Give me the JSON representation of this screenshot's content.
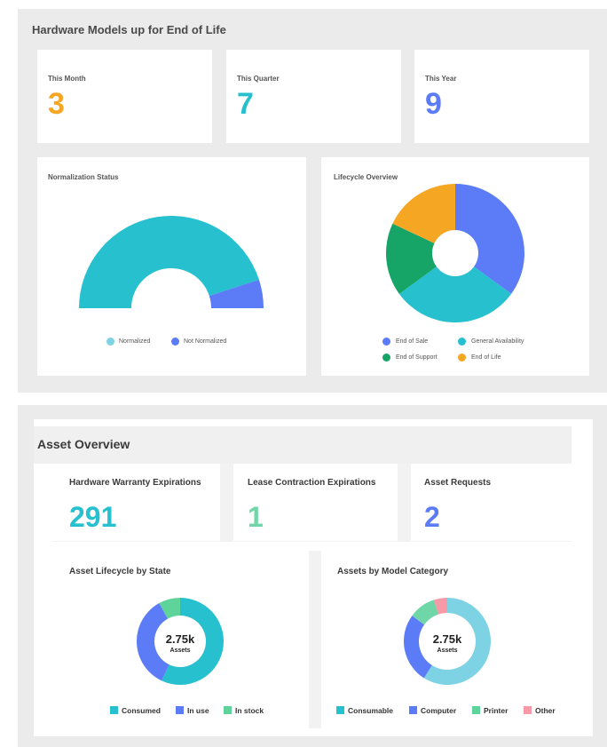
{
  "eol": {
    "title": "Hardware Models up for End of Life",
    "this_month_label": "This Month",
    "this_month_value": "3",
    "this_quarter_label": "This Quarter",
    "this_quarter_value": "7",
    "this_year_label": "This Year",
    "this_year_value": "9"
  },
  "normalization": {
    "title": "Normalization Status",
    "legend": [
      "Normalized",
      "Not Normalized"
    ]
  },
  "lifecycle": {
    "title": "Lifecycle Overview",
    "legend": [
      "End of Sale",
      "General Availability",
      "End of Support",
      "End of Life"
    ]
  },
  "asset_overview": {
    "title": "Asset Overview",
    "warranty_label": "Hardware Warranty Expirations",
    "warranty_value": "291",
    "lease_label": "Lease Contraction Expirations",
    "lease_value": "1",
    "requests_label": "Asset Requests",
    "requests_value": "2"
  },
  "asset_lifecycle": {
    "title": "Asset Lifecycle by State",
    "center_value": "2.75k",
    "center_label": "Assets",
    "legend": [
      "Consumed",
      "In use",
      "In stock"
    ]
  },
  "model_category": {
    "title": "Assets by Model Category",
    "center_value": "2.75k",
    "center_label": "Assets",
    "legend": [
      "Consumable",
      "Computer",
      "Printer",
      "Other"
    ]
  },
  "colors": {
    "orange": "#f5a623",
    "teal": "#26c0cf",
    "blue": "#5b7cf6",
    "green": "#16a567",
    "light_teal": "#7dd3e3",
    "light_green": "#6fd6a8",
    "pink": "#f59aa6",
    "mint": "#5ed39a"
  },
  "chart_data": [
    {
      "type": "pie",
      "title": "Normalization Status",
      "categories": [
        "Normalized",
        "Not Normalized"
      ],
      "values": [
        90,
        10
      ]
    },
    {
      "type": "pie",
      "title": "Lifecycle Overview",
      "categories": [
        "End of Sale",
        "General Availability",
        "End of Support",
        "End of Life"
      ],
      "values": [
        35,
        30,
        17,
        18
      ]
    },
    {
      "type": "pie",
      "title": "Asset Lifecycle by State",
      "categories": [
        "Consumed",
        "In use",
        "In stock"
      ],
      "values": [
        57,
        35,
        8
      ]
    },
    {
      "type": "pie",
      "title": "Assets by Model Category",
      "categories": [
        "Consumable",
        "Computer",
        "Printer",
        "Other"
      ],
      "values": [
        59,
        26,
        10,
        5
      ]
    }
  ]
}
